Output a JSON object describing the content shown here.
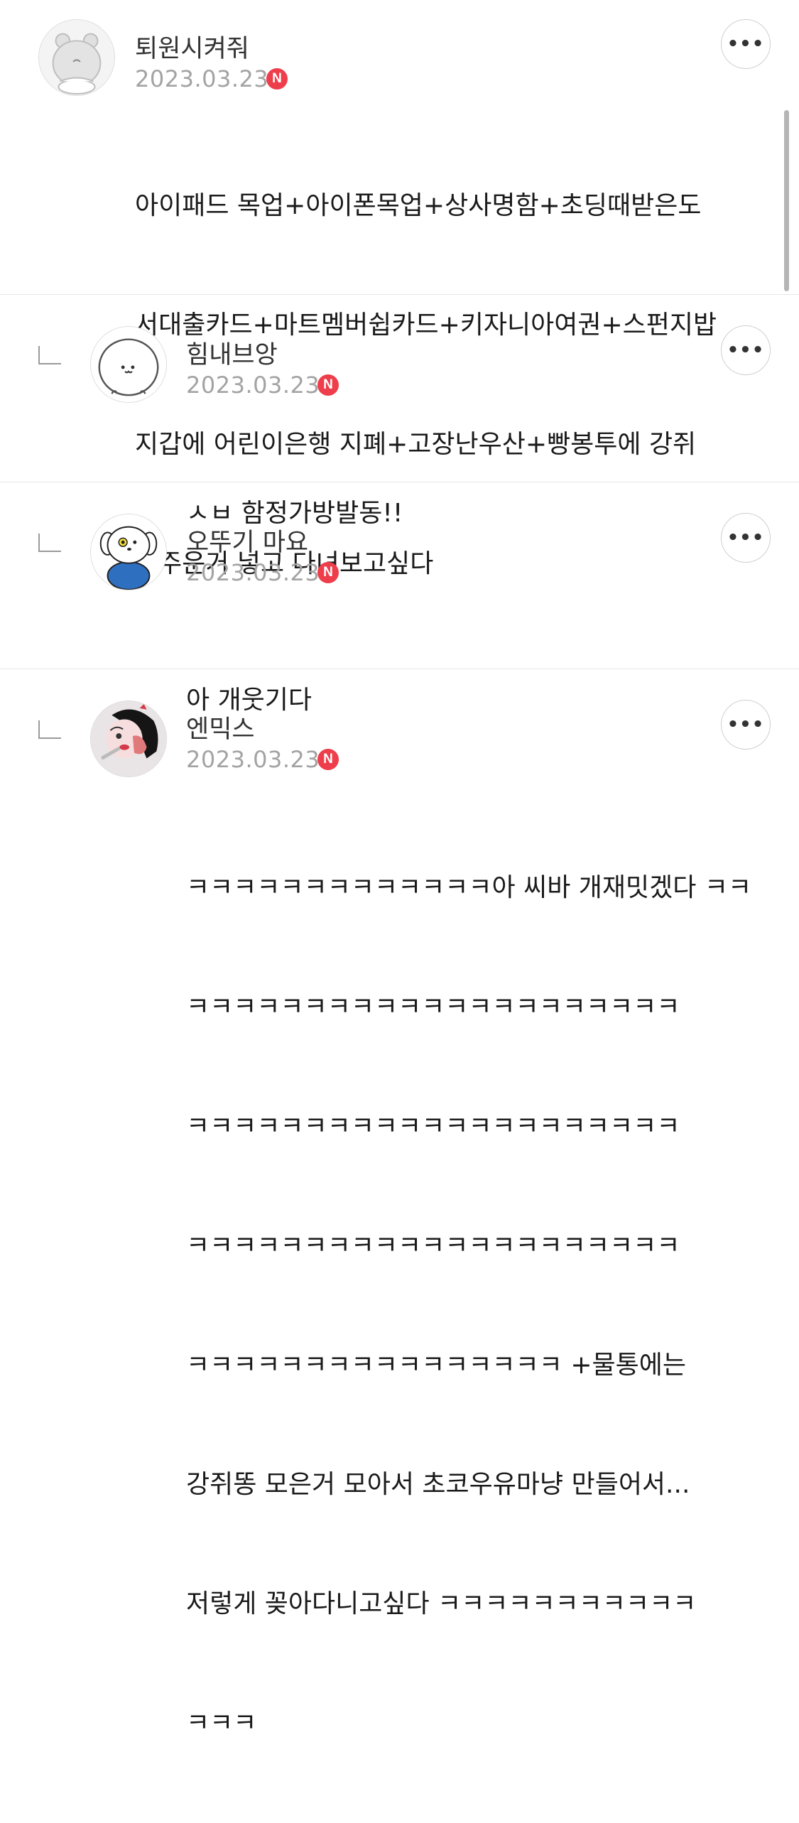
{
  "comments": [
    {
      "author": "퇴원시켜줘",
      "date": "2023.03.23",
      "badge": "N",
      "more": "•••",
      "is_reply": false,
      "avatar_icon": "bear-character-icon",
      "lines": [
        "아이패드 목업+아이폰목업+상사명함+초딩때받은도",
        "서대출카드+마트멤버쉽카드+키자니아여권+스펀지밥",
        "지갑에 어린이은행 지폐+고장난우산+빵봉투에 강쥐",
        "똥주운거 넣고 다녀보고싶다"
      ]
    },
    {
      "author": "힘내브앙",
      "date": "2023.03.23",
      "badge": "N",
      "more": "•••",
      "is_reply": true,
      "avatar_icon": "white-seal-character-icon",
      "lines": [
        "ㅅㅂ 함정가방발동!!"
      ]
    },
    {
      "author": "오뚜기 마요",
      "date": "2023.03.23",
      "badge": "N",
      "more": "•••",
      "is_reply": true,
      "avatar_icon": "puppy-character-icon",
      "lines": [
        "아 개웃기다"
      ]
    },
    {
      "author": "엔믹스",
      "date": "2023.03.23",
      "badge": "N",
      "more": "•••",
      "is_reply": true,
      "avatar_icon": "illustrated-girl-icon",
      "lines": [
        "ㅋㅋㅋㅋㅋㅋㅋㅋㅋㅋㅋㅋㅋ아 씨바 개재밋겠다 ㅋㅋ",
        "ㅋㅋㅋㅋㅋㅋㅋㅋㅋㅋㅋㅋㅋㅋㅋㅋㅋㅋㅋㅋㅋ",
        "ㅋㅋㅋㅋㅋㅋㅋㅋㅋㅋㅋㅋㅋㅋㅋㅋㅋㅋㅋㅋㅋ",
        "ㅋㅋㅋㅋㅋㅋㅋㅋㅋㅋㅋㅋㅋㅋㅋㅋㅋㅋㅋㅋㅋ",
        "ㅋㅋㅋㅋㅋㅋㅋㅋㅋㅋㅋㅋㅋㅋㅋㅋ +물통에는",
        "강쥐똥 모은거 모아서 초코우유마냥 만들어서...",
        "저렇게 꽂아다니고싶다 ㅋㅋㅋㅋㅋㅋㅋㅋㅋㅋㅋ",
        "ㅋㅋㅋ"
      ]
    }
  ],
  "colors": {
    "badge": "#ee3d4b",
    "date": "#a3a3a3",
    "divider": "#e6e6e6"
  }
}
